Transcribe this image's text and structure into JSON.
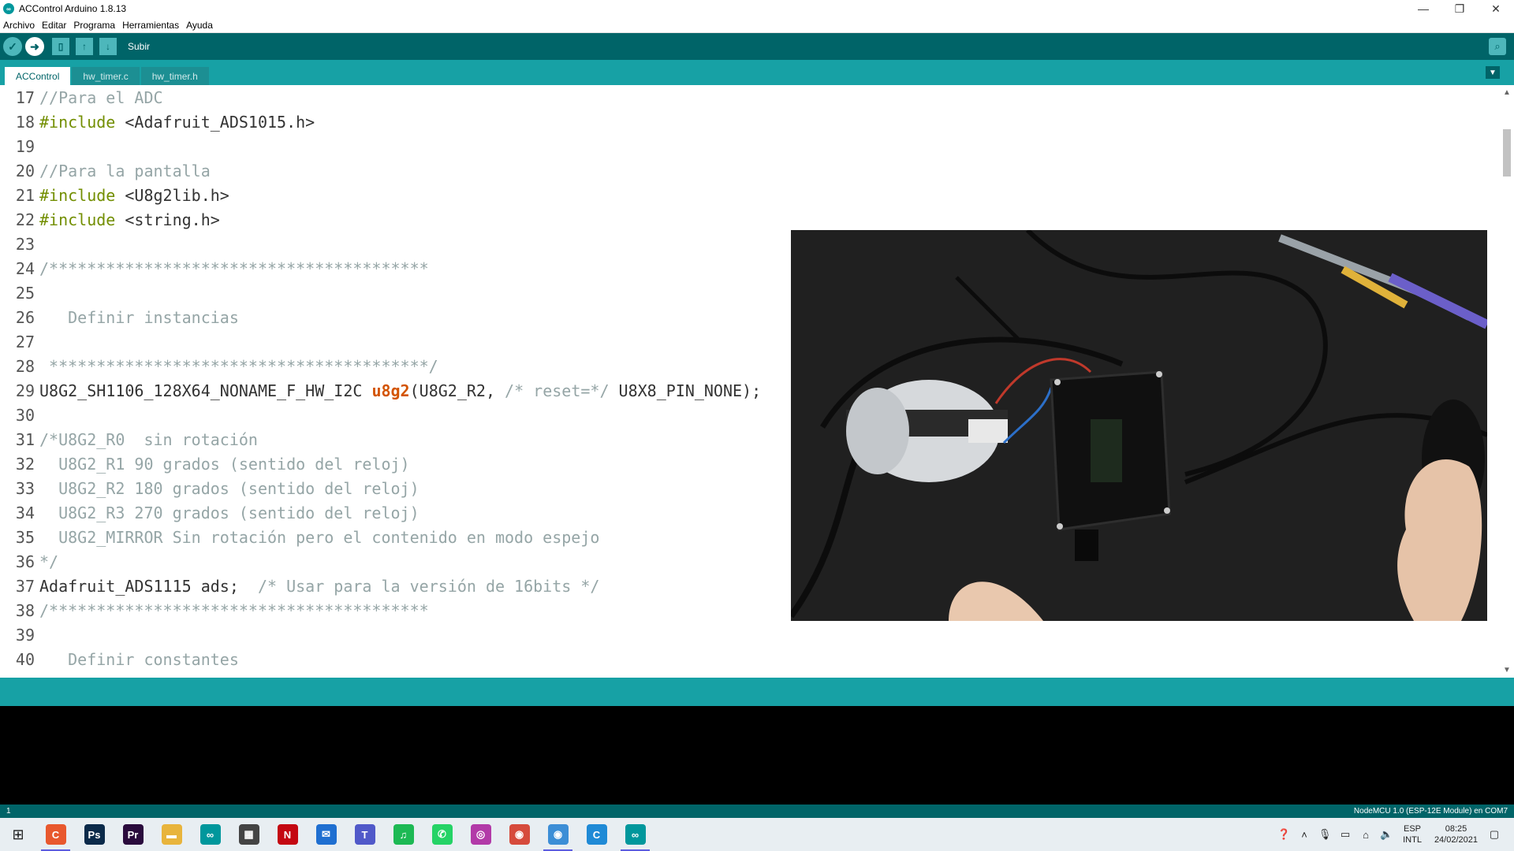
{
  "window": {
    "title": "ACControl Arduino 1.8.13",
    "minimize_glyph": "—",
    "maximize_glyph": "❐",
    "close_glyph": "✕"
  },
  "menu": [
    "Archivo",
    "Editar",
    "Programa",
    "Herramientas",
    "Ayuda"
  ],
  "toolbar": {
    "hover_label": "Subir",
    "verify_icon": "check-icon",
    "upload_icon": "arrow-right-icon",
    "new_icon": "new-file-icon",
    "open_icon": "arrow-up-icon",
    "save_icon": "arrow-down-icon",
    "serial_icon": "magnifier-icon"
  },
  "tabs": [
    {
      "label": "ACControl",
      "active": true
    },
    {
      "label": "hw_timer.c",
      "active": false
    },
    {
      "label": "hw_timer.h",
      "active": false
    }
  ],
  "code": [
    {
      "n": "17",
      "parts": [
        {
          "c": "comment",
          "t": "//Para el ADC"
        }
      ]
    },
    {
      "n": "18",
      "parts": [
        {
          "c": "kw",
          "t": "#include"
        },
        {
          "c": "normal",
          "t": " <Adafruit_ADS1015.h>"
        }
      ]
    },
    {
      "n": "19",
      "parts": []
    },
    {
      "n": "20",
      "parts": [
        {
          "c": "comment",
          "t": "//Para la pantalla"
        }
      ]
    },
    {
      "n": "21",
      "parts": [
        {
          "c": "kw",
          "t": "#include"
        },
        {
          "c": "normal",
          "t": " <U8g2lib.h>"
        }
      ]
    },
    {
      "n": "22",
      "parts": [
        {
          "c": "kw",
          "t": "#include"
        },
        {
          "c": "normal",
          "t": " <string.h>"
        }
      ]
    },
    {
      "n": "23",
      "parts": []
    },
    {
      "n": "24",
      "parts": [
        {
          "c": "comment",
          "t": "/****************************************"
        }
      ]
    },
    {
      "n": "25",
      "parts": []
    },
    {
      "n": "26",
      "parts": [
        {
          "c": "comment",
          "t": "   Definir instancias"
        }
      ]
    },
    {
      "n": "27",
      "parts": []
    },
    {
      "n": "28",
      "parts": [
        {
          "c": "comment",
          "t": " ****************************************/"
        }
      ]
    },
    {
      "n": "29",
      "parts": [
        {
          "c": "normal",
          "t": "U8G2_SH1106_128X64_NONAME_F_HW_I2C "
        },
        {
          "c": "func",
          "t": "u8g2"
        },
        {
          "c": "normal",
          "t": "(U8G2_R2, "
        },
        {
          "c": "comment",
          "t": "/* reset=*/"
        },
        {
          "c": "normal",
          "t": " U8X8_PIN_NONE);"
        }
      ]
    },
    {
      "n": "30",
      "parts": []
    },
    {
      "n": "31",
      "parts": [
        {
          "c": "comment",
          "t": "/*U8G2_R0  sin rotación"
        }
      ]
    },
    {
      "n": "32",
      "parts": [
        {
          "c": "comment",
          "t": "  U8G2_R1 90 grados (sentido del reloj)"
        }
      ]
    },
    {
      "n": "33",
      "parts": [
        {
          "c": "comment",
          "t": "  U8G2_R2 180 grados (sentido del reloj)"
        }
      ]
    },
    {
      "n": "34",
      "parts": [
        {
          "c": "comment",
          "t": "  U8G2_R3 270 grados (sentido del reloj)"
        }
      ]
    },
    {
      "n": "35",
      "parts": [
        {
          "c": "comment",
          "t": "  U8G2_MIRROR Sin rotación pero el contenido en modo espejo"
        }
      ]
    },
    {
      "n": "36",
      "parts": [
        {
          "c": "comment",
          "t": "*/"
        }
      ]
    },
    {
      "n": "37",
      "parts": [
        {
          "c": "normal",
          "t": "Adafruit_ADS1115 ads;  "
        },
        {
          "c": "comment",
          "t": "/* Usar para la versión de 16bits */"
        }
      ]
    },
    {
      "n": "38",
      "parts": [
        {
          "c": "comment",
          "t": "/****************************************"
        }
      ]
    },
    {
      "n": "39",
      "parts": []
    },
    {
      "n": "40",
      "parts": [
        {
          "c": "comment",
          "t": "   Definir constantes"
        }
      ]
    }
  ],
  "status": {
    "line_number": "1",
    "board": "NodeMCU 1.0 (ESP-12E Module) en COM7"
  },
  "taskbar": {
    "apps": [
      {
        "name": "codecanyon-icon",
        "glyph": "C",
        "color": "#e8582e",
        "running": true
      },
      {
        "name": "photoshop-icon",
        "glyph": "Ps",
        "color": "#0b2a4a",
        "running": false
      },
      {
        "name": "premiere-icon",
        "glyph": "Pr",
        "color": "#2a0b3d",
        "running": false
      },
      {
        "name": "file-explorer-icon",
        "glyph": "▬",
        "color": "#e8b43c",
        "running": false
      },
      {
        "name": "arduino-icon",
        "glyph": "∞",
        "color": "#00979c",
        "running": false
      },
      {
        "name": "store-icon",
        "glyph": "▦",
        "color": "#444444",
        "running": false
      },
      {
        "name": "netflix-icon",
        "glyph": "N",
        "color": "#c40812",
        "running": false
      },
      {
        "name": "mail-icon",
        "glyph": "✉",
        "color": "#1f6fd1",
        "running": false
      },
      {
        "name": "teams-icon",
        "glyph": "T",
        "color": "#5059c9",
        "running": false
      },
      {
        "name": "spotify-icon",
        "glyph": "♫",
        "color": "#1db954",
        "running": false
      },
      {
        "name": "whatsapp-icon",
        "glyph": "✆",
        "color": "#25d366",
        "running": false
      },
      {
        "name": "instagram-icon",
        "glyph": "◎",
        "color": "#b23aa8",
        "running": false
      },
      {
        "name": "chrome-icon",
        "glyph": "◉",
        "color": "#d64b3c",
        "running": false
      },
      {
        "name": "chrome-profile-icon",
        "glyph": "◉",
        "color": "#3c8ed6",
        "running": true
      },
      {
        "name": "app-c-icon",
        "glyph": "C",
        "color": "#1f8ad6",
        "running": false
      },
      {
        "name": "arduino-running-icon",
        "glyph": "∞",
        "color": "#00979c",
        "running": true
      }
    ],
    "lang": "ESP",
    "layout": "INTL",
    "time": "08:25",
    "date": "24/02/2021"
  }
}
